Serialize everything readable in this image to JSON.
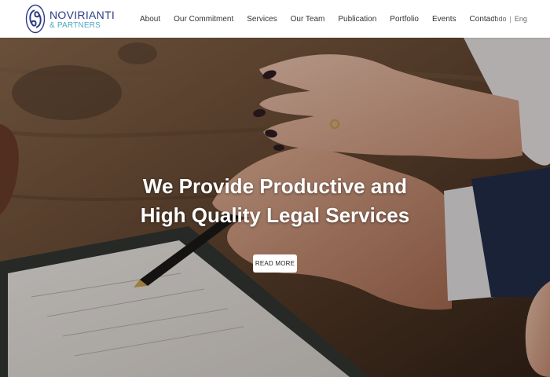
{
  "logo": {
    "name": "NOVIRIANTI",
    "sub": "& PARTNERS"
  },
  "nav": [
    {
      "label": "About"
    },
    {
      "label": "Our Commitment"
    },
    {
      "label": "Services"
    },
    {
      "label": "Our Team"
    },
    {
      "label": "Publication"
    },
    {
      "label": "Portfolio"
    },
    {
      "label": "Events"
    },
    {
      "label": "Contact"
    }
  ],
  "lang": {
    "indo": "Indo",
    "separator": "|",
    "eng": "Eng"
  },
  "hero": {
    "headline_line1": "We Provide Productive and",
    "headline_line2": "High Quality Legal Services",
    "button": "READ MORE"
  },
  "colors": {
    "brand_navy": "#2a3b86",
    "brand_teal": "#4aa8c4",
    "headline": "#ffffff"
  }
}
